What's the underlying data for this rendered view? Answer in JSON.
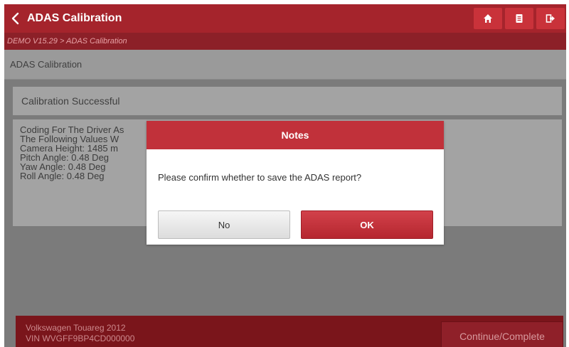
{
  "header": {
    "title": "ADAS Calibration",
    "back_icon": "chevron-left-icon",
    "actions": [
      {
        "icon": "home-icon"
      },
      {
        "icon": "document-icon"
      },
      {
        "icon": "exit-icon"
      }
    ]
  },
  "breadcrumb": "DEMO V15.29 > ADAS Calibration",
  "section_title": "ADAS Calibration",
  "status": "Calibration Successful",
  "details": [
    "Coding For The Driver As",
    "The Following Values W",
    "Camera Height: 1485 m",
    "Pitch Angle: 0.48 Deg",
    "Yaw Angle: 0.48 Deg",
    "Roll Angle: 0.48 Deg"
  ],
  "footer": {
    "vehicle": "Volkswagen Touareg 2012",
    "vin": "VIN WVGFF9BP4CD000000",
    "continue_label": "Continue/Complete"
  },
  "dialog": {
    "title": "Notes",
    "message": "Please confirm whether to save the ADAS report?",
    "no_label": "No",
    "ok_label": "OK"
  },
  "colors": {
    "accent": "#a5242c",
    "dialog_header": "#c1313a",
    "ok_button": "#c1313a"
  }
}
